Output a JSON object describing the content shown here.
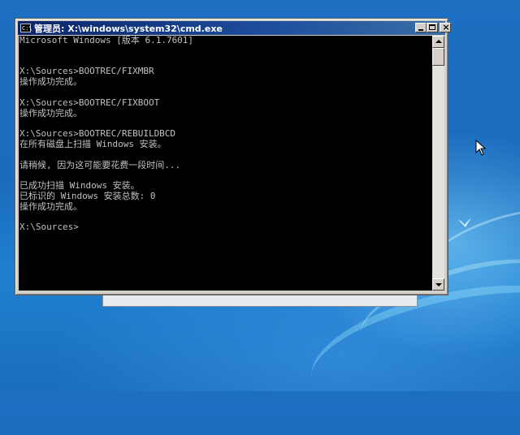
{
  "window": {
    "title": "管理员: X:\\windows\\system32\\cmd.exe",
    "icon": "cmd-icon",
    "icon_text": "C:\\",
    "buttons": [
      "minimize",
      "maximize",
      "close"
    ],
    "close_glyph": "×"
  },
  "console": {
    "lines": [
      "Microsoft Windows [版本 6.1.7601]",
      "",
      "",
      "X:\\Sources>BOOTREC/FIXMBR",
      "操作成功完成。",
      "",
      "X:\\Sources>BOOTREC/FIXBOOT",
      "操作成功完成。",
      "",
      "X:\\Sources>BOOTREC/REBUILDBCD",
      "在所有磁盘上扫描 Windows 安装。",
      "",
      "请稍候, 因为这可能要花费一段时间...",
      "",
      "已成功扫描 Windows 安装。",
      "已标识的 Windows 安装总数: 0",
      "操作成功完成。",
      "",
      "X:\\Sources>"
    ]
  },
  "desktop": {
    "background": "windows-7-blue",
    "accent": "#1a6bbd",
    "cursor": "arrow-cursor",
    "decoration": "bird-icon"
  }
}
